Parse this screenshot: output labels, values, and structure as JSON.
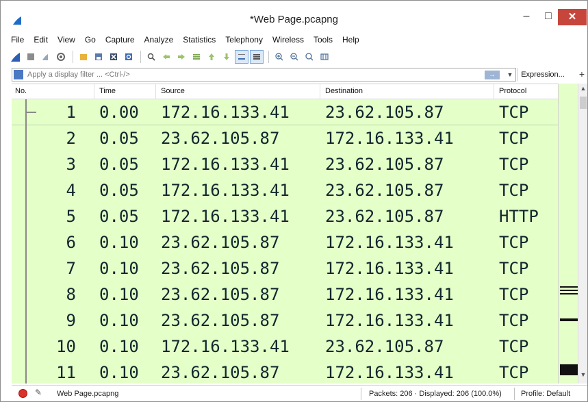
{
  "window": {
    "title": "*Web Page.pcapng",
    "minimize": "–",
    "maximize": "□",
    "close": "✕"
  },
  "menu": [
    "File",
    "Edit",
    "View",
    "Go",
    "Capture",
    "Analyze",
    "Statistics",
    "Telephony",
    "Wireless",
    "Tools",
    "Help"
  ],
  "toolbar": {
    "icons": [
      "shark-fin-start-icon",
      "stop-icon",
      "restart-icon",
      "options-icon",
      "open-icon",
      "save-icon",
      "close-file-icon",
      "reload-icon",
      "find-icon",
      "back-icon",
      "forward-icon",
      "goto-packet-icon",
      "first-packet-icon",
      "last-packet-icon",
      "autoscroll-icon",
      "colorize-icon",
      "zoom-in-icon",
      "zoom-out-icon",
      "normal-size-icon",
      "resize-columns-icon"
    ]
  },
  "filter": {
    "placeholder": "Apply a display filter ... <Ctrl-/>",
    "expression_label": "Expression...",
    "plus_label": "+"
  },
  "columns": {
    "no": "No.",
    "time": "Time",
    "source": "Source",
    "destination": "Destination",
    "protocol": "Protocol"
  },
  "packets": [
    {
      "no": "1",
      "time": "0.00",
      "source": "172.16.133.41",
      "destination": "23.62.105.87",
      "protocol": "TCP"
    },
    {
      "no": "2",
      "time": "0.05",
      "source": "23.62.105.87",
      "destination": "172.16.133.41",
      "protocol": "TCP"
    },
    {
      "no": "3",
      "time": "0.05",
      "source": "172.16.133.41",
      "destination": "23.62.105.87",
      "protocol": "TCP"
    },
    {
      "no": "4",
      "time": "0.05",
      "source": "172.16.133.41",
      "destination": "23.62.105.87",
      "protocol": "TCP"
    },
    {
      "no": "5",
      "time": "0.05",
      "source": "172.16.133.41",
      "destination": "23.62.105.87",
      "protocol": "HTTP"
    },
    {
      "no": "6",
      "time": "0.10",
      "source": "23.62.105.87",
      "destination": "172.16.133.41",
      "protocol": "TCP"
    },
    {
      "no": "7",
      "time": "0.10",
      "source": "23.62.105.87",
      "destination": "172.16.133.41",
      "protocol": "TCP"
    },
    {
      "no": "8",
      "time": "0.10",
      "source": "23.62.105.87",
      "destination": "172.16.133.41",
      "protocol": "TCP"
    },
    {
      "no": "9",
      "time": "0.10",
      "source": "23.62.105.87",
      "destination": "172.16.133.41",
      "protocol": "TCP"
    },
    {
      "no": "10",
      "time": "0.10",
      "source": "172.16.133.41",
      "destination": "23.62.105.87",
      "protocol": "TCP"
    },
    {
      "no": "11",
      "time": "0.10",
      "source": "23.62.105.87",
      "destination": "172.16.133.41",
      "protocol": "TCP"
    }
  ],
  "colors": {
    "row_bg": "#e4ffc7",
    "row_text": "#12272e",
    "close_button": "#c7463b",
    "status_dot": "#d9322a"
  },
  "status": {
    "file": "Web Page.pcapng",
    "packets": "Packets: 206 · Displayed: 206 (100.0%)",
    "profile": "Profile: Default"
  }
}
